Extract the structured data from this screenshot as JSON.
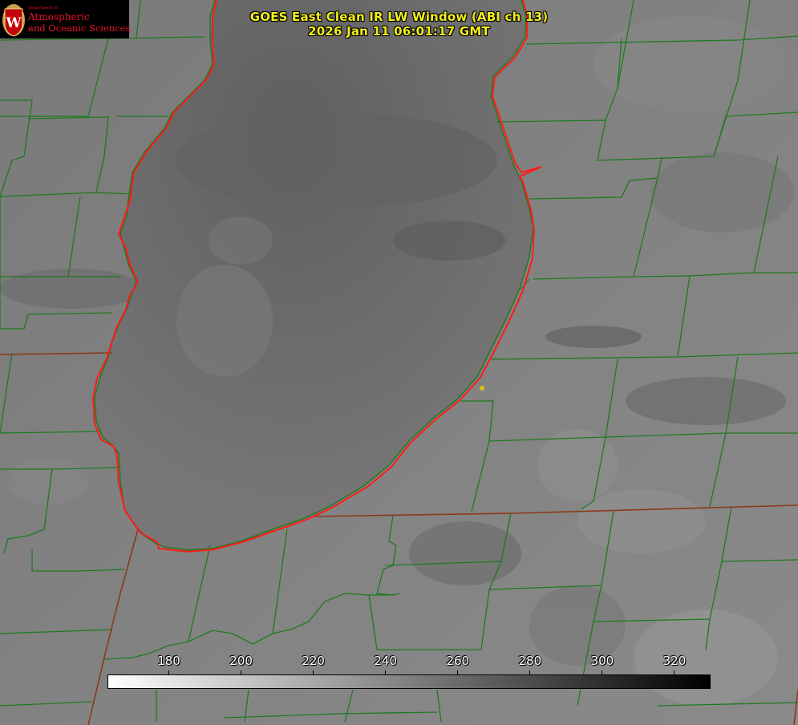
{
  "title": {
    "line1": "GOES East Clean IR LW Window (ABI ch 13)",
    "line2": "2026 Jan 11 06:01:17 GMT"
  },
  "logo": {
    "department": "Department of",
    "line1": "Atmospheric",
    "line2": "and Oceanic Sciences",
    "shield_letter": "W"
  },
  "colorbar": {
    "min": 163,
    "max": 330,
    "ticks": [
      "180",
      "200",
      "220",
      "240",
      "260",
      "280",
      "300",
      "320"
    ],
    "tick_values": [
      180,
      200,
      220,
      240,
      260,
      280,
      300,
      320
    ],
    "start_color": "#ffffff",
    "end_color": "#000000"
  },
  "colors": {
    "background": "#7d7d7d",
    "lake": "#6e6e6e",
    "shoreline": "#ff1a1a",
    "county_lines": "#1f7a1f",
    "state_lines": "#8b3a1a",
    "title_text": "#f2ee1a",
    "point_marker": "#d8c21a"
  }
}
